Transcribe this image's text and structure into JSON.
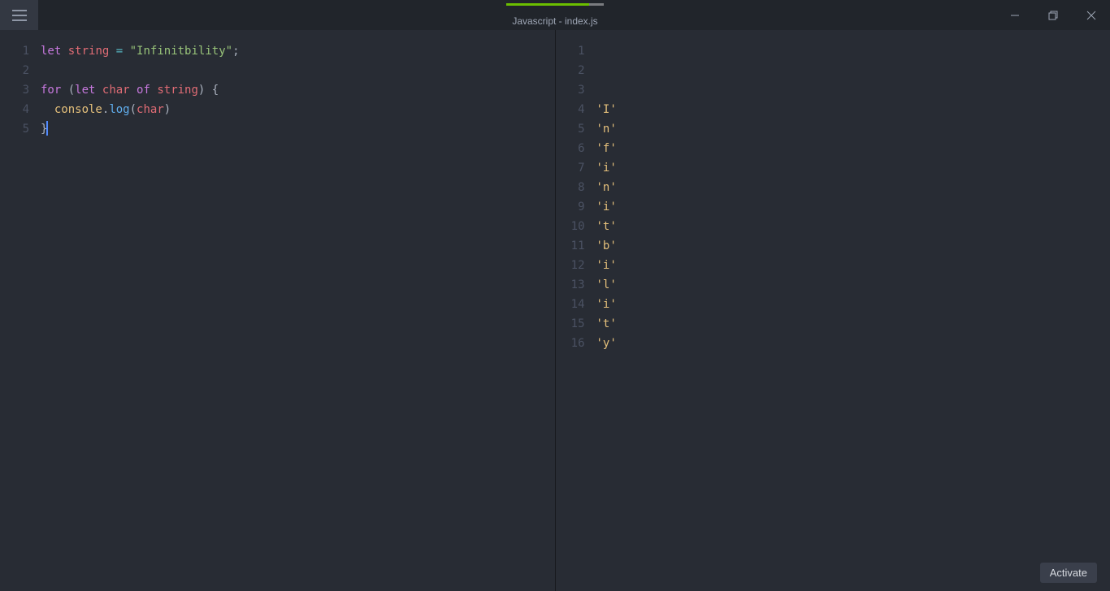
{
  "window": {
    "title": "Javascript - index.js"
  },
  "leftPane": {
    "lines": [
      1,
      2,
      3,
      4,
      5
    ],
    "code": [
      [
        {
          "t": "let",
          "c": "tk-kw"
        },
        {
          "t": " ",
          "c": "tk-pn"
        },
        {
          "t": "string",
          "c": "tk-var"
        },
        {
          "t": " ",
          "c": "tk-pn"
        },
        {
          "t": "=",
          "c": "tk-op"
        },
        {
          "t": " ",
          "c": "tk-pn"
        },
        {
          "t": "\"Infinitbility\"",
          "c": "tk-str"
        },
        {
          "t": ";",
          "c": "tk-pn"
        }
      ],
      [],
      [
        {
          "t": "for",
          "c": "tk-kw"
        },
        {
          "t": " (",
          "c": "tk-pn"
        },
        {
          "t": "let",
          "c": "tk-kw"
        },
        {
          "t": " ",
          "c": "tk-pn"
        },
        {
          "t": "char",
          "c": "tk-var"
        },
        {
          "t": " ",
          "c": "tk-pn"
        },
        {
          "t": "of",
          "c": "tk-kw"
        },
        {
          "t": " ",
          "c": "tk-pn"
        },
        {
          "t": "string",
          "c": "tk-var"
        },
        {
          "t": ")",
          "c": "tk-pn"
        },
        {
          "t": " {",
          "c": "tk-pn"
        }
      ],
      [
        {
          "t": "  ",
          "c": "tk-pn"
        },
        {
          "t": "console",
          "c": "tk-id"
        },
        {
          "t": ".",
          "c": "tk-pn"
        },
        {
          "t": "log",
          "c": "tk-fn"
        },
        {
          "t": "(",
          "c": "tk-pn"
        },
        {
          "t": "char",
          "c": "tk-var"
        },
        {
          "t": ")",
          "c": "tk-pn"
        }
      ],
      [
        {
          "t": "}",
          "c": "tk-pn",
          "cursor": true
        }
      ]
    ]
  },
  "rightPane": {
    "lines": [
      1,
      2,
      3,
      4,
      5,
      6,
      7,
      8,
      9,
      10,
      11,
      12,
      13,
      14,
      15,
      16
    ],
    "out": [
      "",
      "",
      "",
      "'I'",
      "'n'",
      "'f'",
      "'i'",
      "'n'",
      "'i'",
      "'t'",
      "'b'",
      "'i'",
      "'l'",
      "'i'",
      "'t'",
      "'y'"
    ]
  },
  "activate": {
    "label": "Activate"
  }
}
